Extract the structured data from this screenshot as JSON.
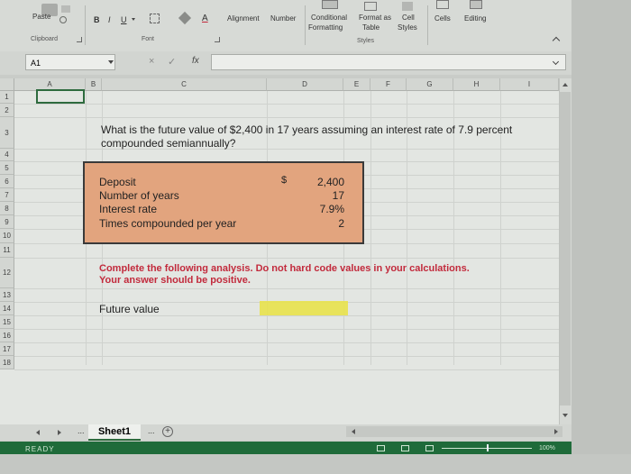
{
  "ribbon": {
    "paste": "Paste",
    "clipboard": "Clipboard",
    "bold": "B",
    "italic": "I",
    "underline": "U",
    "font_color_letter": "A",
    "font_group": "Font",
    "alignment": "Alignment",
    "number": "Number",
    "conditional_formatting_1": "Conditional",
    "conditional_formatting_2": "Formatting",
    "format_as_table_1": "Format as",
    "format_as_table_2": "Table",
    "cell_styles_1": "Cell",
    "cell_styles_2": "Styles",
    "styles_group": "Styles",
    "cells": "Cells",
    "editing": "Editing"
  },
  "formula_bar": {
    "name_box": "A1",
    "fx": "fx",
    "cancel": "×",
    "enter": "✓"
  },
  "columns": [
    "A",
    "B",
    "C",
    "D",
    "E",
    "F",
    "G",
    "H",
    "I"
  ],
  "rows": [
    "1",
    "2",
    "3",
    "4",
    "5",
    "6",
    "7",
    "8",
    "9",
    "10",
    "11",
    "12",
    "13",
    "14",
    "15",
    "16",
    "17",
    "18"
  ],
  "sheet": {
    "question": "What is the future value of $2,400 in 17 years assuming an interest rate of 7.9 percent compounded semiannually?",
    "inputs": [
      {
        "label": "Deposit",
        "value": "2,400"
      },
      {
        "label": "Number of years",
        "value": "17"
      },
      {
        "label": "Interest rate",
        "value": "7.9%"
      },
      {
        "label": "Times compounded per year",
        "value": "2"
      }
    ],
    "currency_symbol": "$",
    "instruction_line1": "Complete the following analysis. Do not hard code values in your calculations.",
    "instruction_line2": "Your answer should be positive.",
    "output_label": "Future value"
  },
  "tabs": {
    "sheet_name": "Sheet1",
    "more": "...",
    "add": "+"
  },
  "status": {
    "text": "READY",
    "zoom": "100%"
  },
  "colors": {
    "input_box": "#e2a47e",
    "answer_cell": "#e8e24d",
    "instruction": "#c22a3c",
    "status_bar": "#1f6b3a"
  }
}
